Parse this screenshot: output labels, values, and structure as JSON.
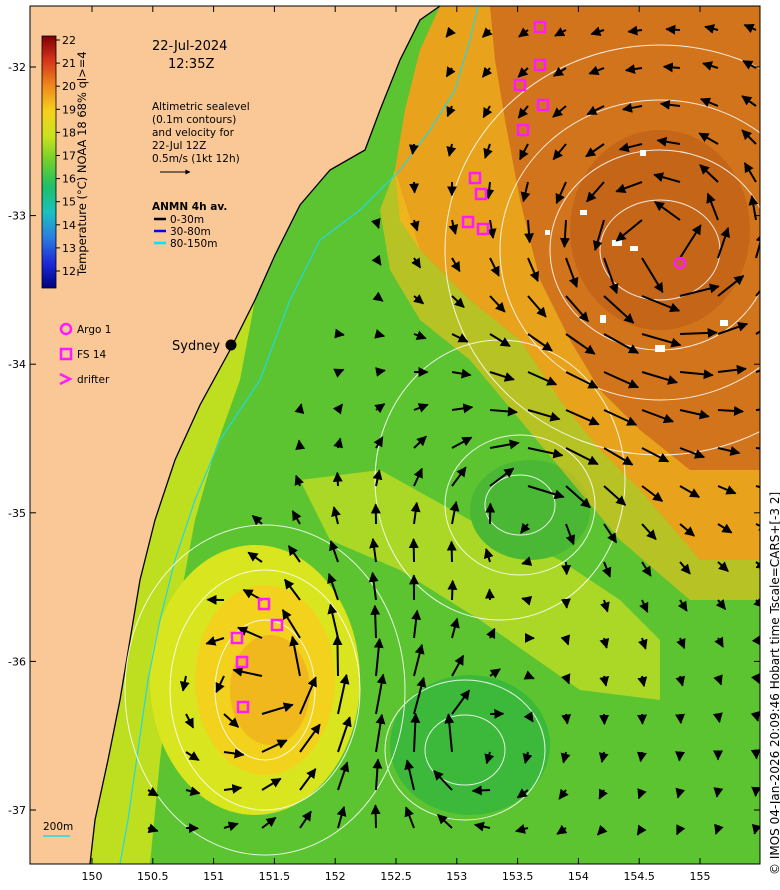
{
  "header": {
    "date": "22-Jul-2024",
    "time": "12:35Z"
  },
  "altimetry_note": [
    "Altimetric sealevel",
    "(0.1m contours)",
    "and velocity for",
    "22-Jul 12Z",
    "0.5m/s (1kt 12h)"
  ],
  "anmn": {
    "title": "ANMN 4h av.",
    "items": [
      {
        "label": "0-30m",
        "color": "#000000"
      },
      {
        "label": "30-80m",
        "color": "#0000ff"
      },
      {
        "label": "80-150m",
        "color": "#00e5ff"
      }
    ]
  },
  "colorbar": {
    "label": "Temperature (°C) NOAA 18 68% ql>=4",
    "ticks": [
      "22",
      "21",
      "20",
      "19",
      "18",
      "17",
      "16",
      "15",
      "14",
      "13",
      "12"
    ]
  },
  "symbols_legend": [
    {
      "label": "Argo 1",
      "symbol": "circle-icon"
    },
    {
      "label": "FS 14",
      "symbol": "square-icon"
    },
    {
      "label": "drifter",
      "symbol": "chevron-icon"
    }
  ],
  "places": {
    "sydney": "Sydney"
  },
  "scale_note": "200m",
  "axes": {
    "x_ticks": [
      "150",
      "150.5",
      "151",
      "151.5",
      "152",
      "152.5",
      "153",
      "153.5",
      "154",
      "154.5",
      "155"
    ],
    "y_ticks": [
      "-32",
      "-33",
      "-34",
      "-35",
      "-36",
      "-37"
    ]
  },
  "credit": "© IMOS 04-Jan-2026 20:09:46 Hobart time Tscale=CARS+[-3 2]",
  "colors": {
    "land": "#f9c896",
    "warm_water": "#d2741c",
    "cool_water": "#5cc431",
    "mid_water": "#c9e11f",
    "magenta": "#ff1aff"
  }
}
